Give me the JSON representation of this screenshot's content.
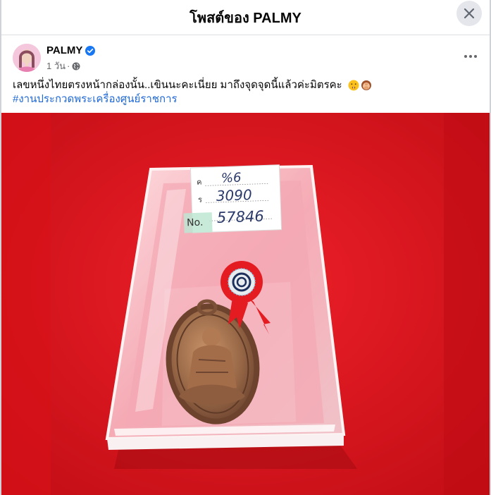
{
  "header": {
    "title": "โพสต์ของ PALMY"
  },
  "post": {
    "author": "PALMY",
    "time": "1 วัน",
    "dot": "·",
    "text": "เลขหนึ่งไทยตรงหน้ากล่องนั้น..เขินนะคะเนี่ยย  มาถึงจุดจุดนี้แล้วค่ะมิตรคะ",
    "hashtag": "#งานประกวดพระเครื่องศูนย์ราชการ",
    "emojis": [
      "shushing-face-icon",
      "person-facepalming-icon"
    ]
  },
  "photo": {
    "card": {
      "row1_prefix": "ค",
      "row1_value": "%6",
      "row2_prefix": "ร",
      "row2_value": "3090",
      "row3_prefix": "No.",
      "row3_value": "57846"
    }
  },
  "colors": {
    "brand_blue": "#1877f2",
    "hashtag_blue": "#1f69d6",
    "background_red": "#e0141d",
    "ribbon_red": "#e41c22"
  }
}
